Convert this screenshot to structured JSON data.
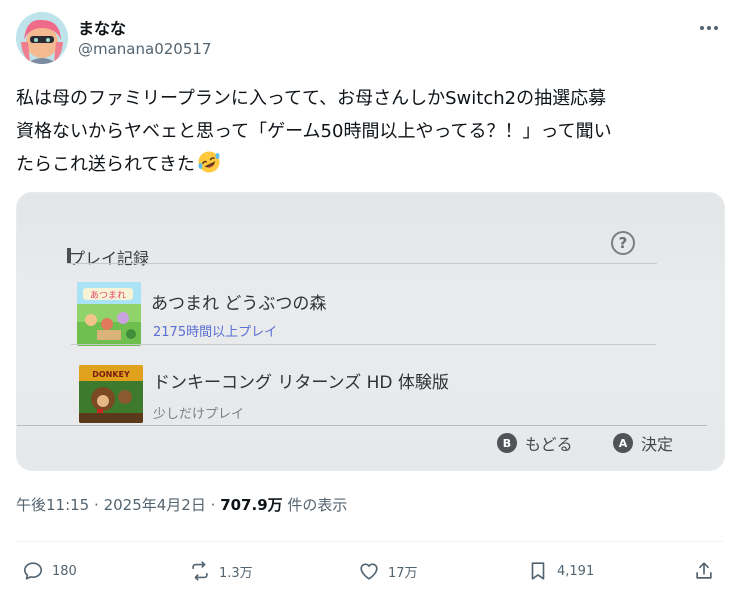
{
  "user": {
    "display_name": "まなな",
    "handle": "@manana020517"
  },
  "post": {
    "text": "私は母のファミリープランに入ってて、お母さんしかSwitch2の抽選応募\n資格ないからヤベェと思って「ゲーム50時間以上やってる？！」って聞い\nたらこれ送られてきた",
    "emoji": "rolling-on-floor-laughing",
    "time": "午後11:15",
    "date": "2025年4月2日",
    "separator": "·",
    "views_count": "707.9万",
    "views_label": "件の表示"
  },
  "media": {
    "section_title": "プレイ記録",
    "help_glyph": "?",
    "games": [
      {
        "title": "あつまれ どうぶつの森",
        "play_time": "2175時間以上プレイ",
        "play_time_color": "#5b6fd6"
      },
      {
        "title": "ドンキーコング リターンズ HD 体験版",
        "play_time": "少しだけプレイ",
        "play_time_color": "#7c8084"
      }
    ],
    "buttons": [
      {
        "key": "B",
        "label": "もどる"
      },
      {
        "key": "A",
        "label": "決定"
      }
    ]
  },
  "actions": {
    "replies": "180",
    "reposts": "1.3万",
    "likes": "17万",
    "bookmarks": "4,191"
  },
  "colors": {
    "text": "#0f1419",
    "secondary": "#536471",
    "accent_playtime": "#5b6fd6"
  }
}
